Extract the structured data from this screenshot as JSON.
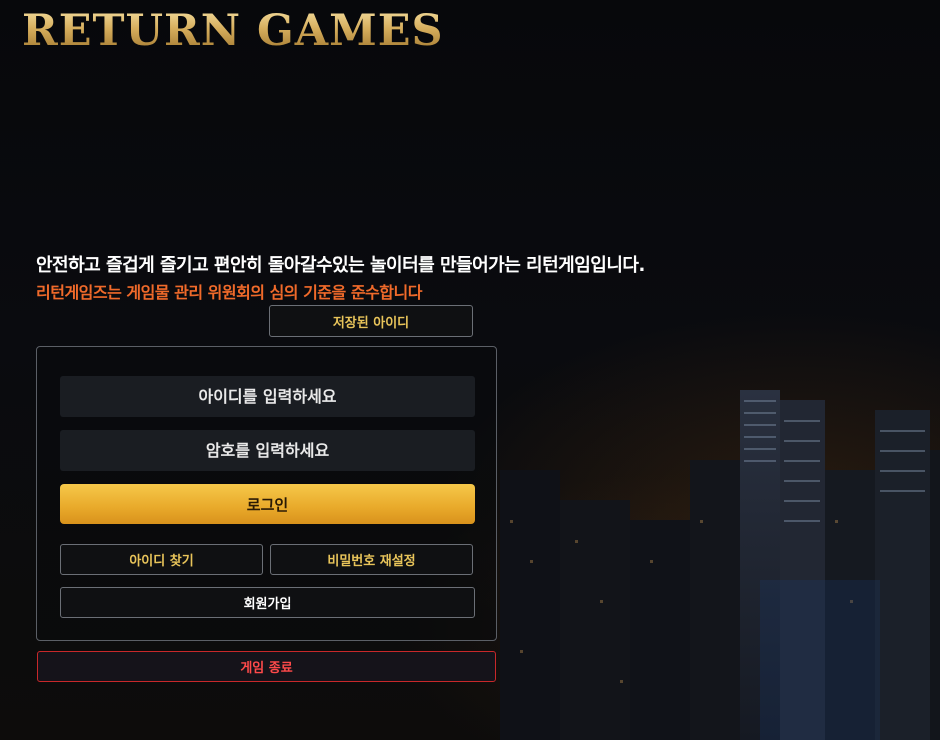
{
  "logo": "RETURN GAMES",
  "tagline": "안전하고 즐겁게 즐기고 편안히 돌아갈수있는 놀이터를 만들어가는 리턴게임입니다.",
  "subline": "리턴게임즈는 게임물 관리 위원회의 심의 기준을 준수합니다",
  "saved_id_button": "저장된 아이디",
  "login_form": {
    "id_placeholder": "아이디를 입력하세요",
    "password_placeholder": "암호를 입력하세요",
    "login_button": "로그인",
    "find_id_button": "아이디 찾기",
    "reset_password_button": "비밀번호 재설정",
    "signup_button": "회원가입"
  },
  "exit_button": "게임 종료",
  "colors": {
    "gold": "#e8c45a",
    "login_button": "#f0b634",
    "notice_orange": "#f06a2a",
    "exit_red": "#c8282a"
  }
}
